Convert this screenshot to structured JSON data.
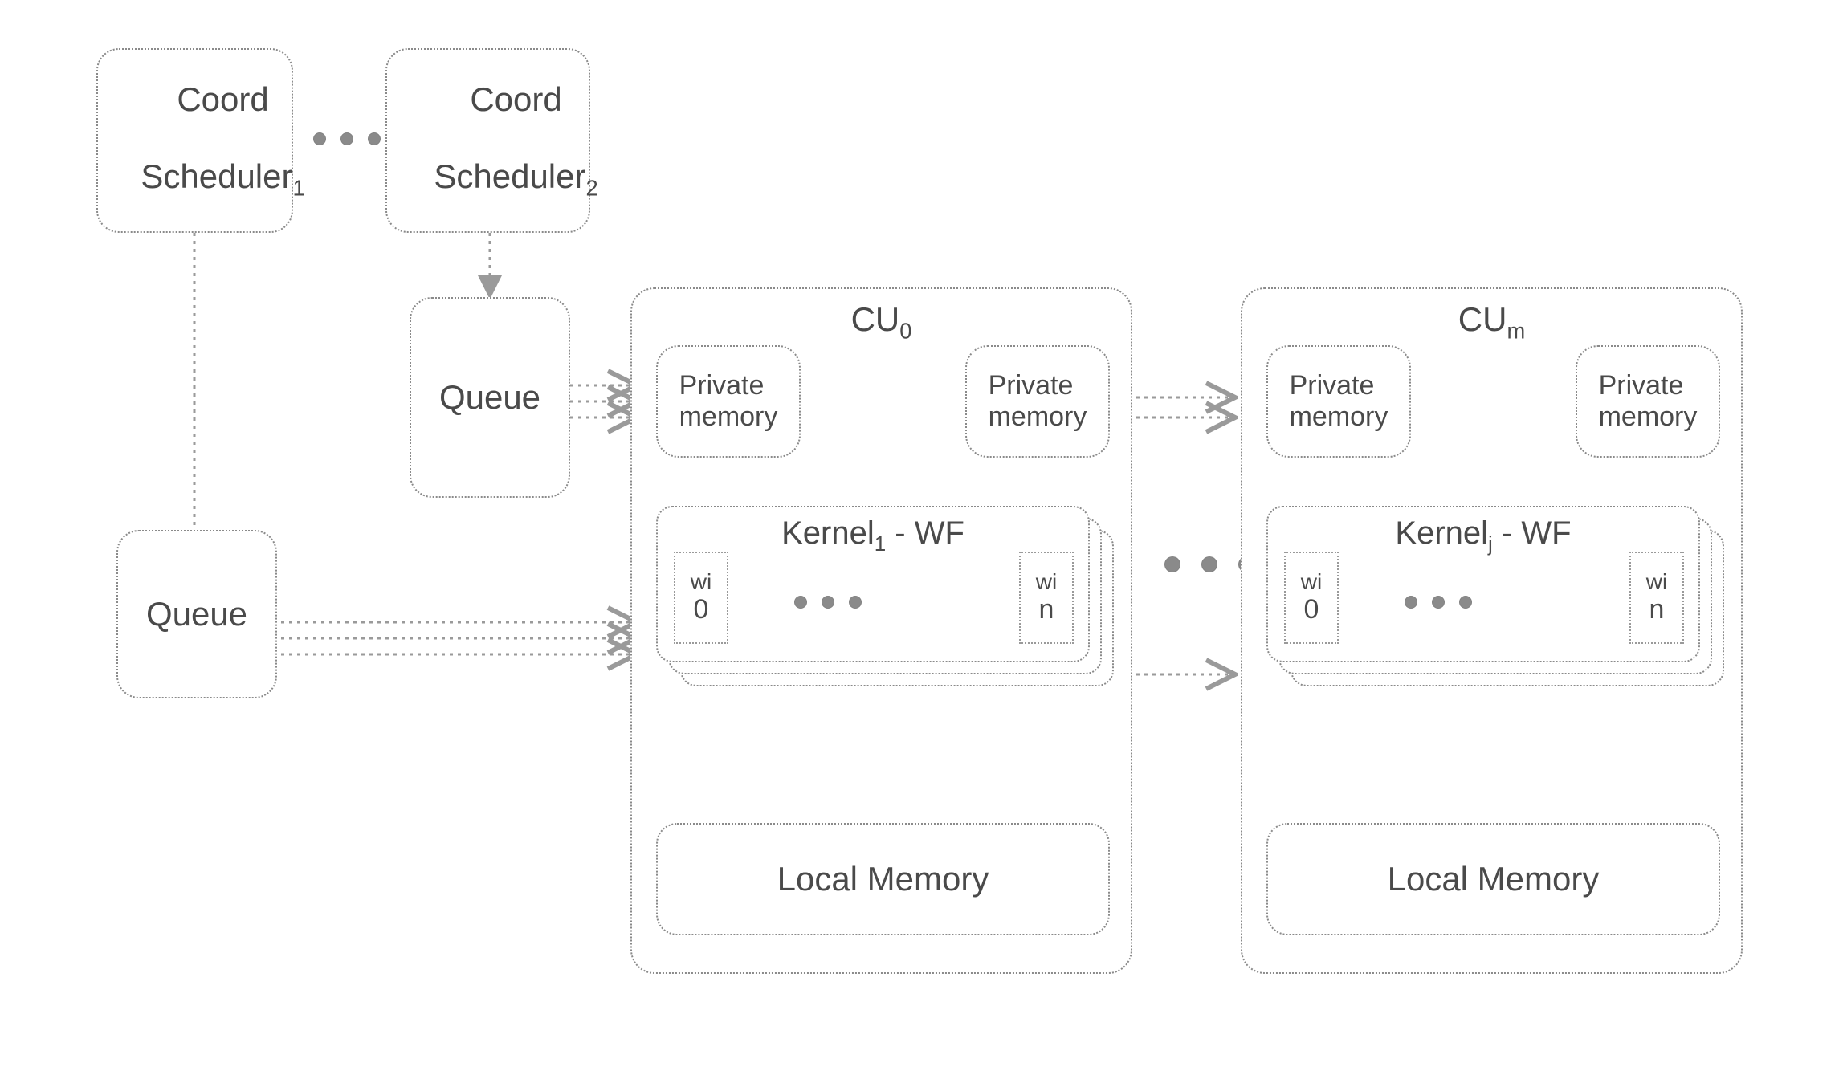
{
  "schedulers": {
    "s1": {
      "line1": "Coord",
      "line2": "Scheduler",
      "sub": "1"
    },
    "s2": {
      "line1": "Coord",
      "line2": "Scheduler",
      "sub": "2"
    }
  },
  "queues": {
    "q1": "Queue",
    "q2": "Queue"
  },
  "cus": {
    "cu0": {
      "title_prefix": "CU",
      "title_sub": "0",
      "priv1": "Private\nmemory",
      "priv2": "Private\nmemory",
      "kernel": {
        "prefix": "Kernel",
        "sub": "1",
        "suffix": " - WF"
      },
      "wi0": {
        "wi": "wi",
        "idx": "0"
      },
      "win": {
        "wi": "wi",
        "idx": "n"
      },
      "local": "Local Memory"
    },
    "cum": {
      "title_prefix": "CU",
      "title_sub": "m",
      "priv1": "Private\nmemory",
      "priv2": "Private\nmemory",
      "kernel": {
        "prefix": "Kernel",
        "sub": "j",
        "suffix": " - WF"
      },
      "wi0": {
        "wi": "wi",
        "idx": "0"
      },
      "win": {
        "wi": "wi",
        "idx": "n"
      },
      "local": "Local Memory"
    }
  }
}
